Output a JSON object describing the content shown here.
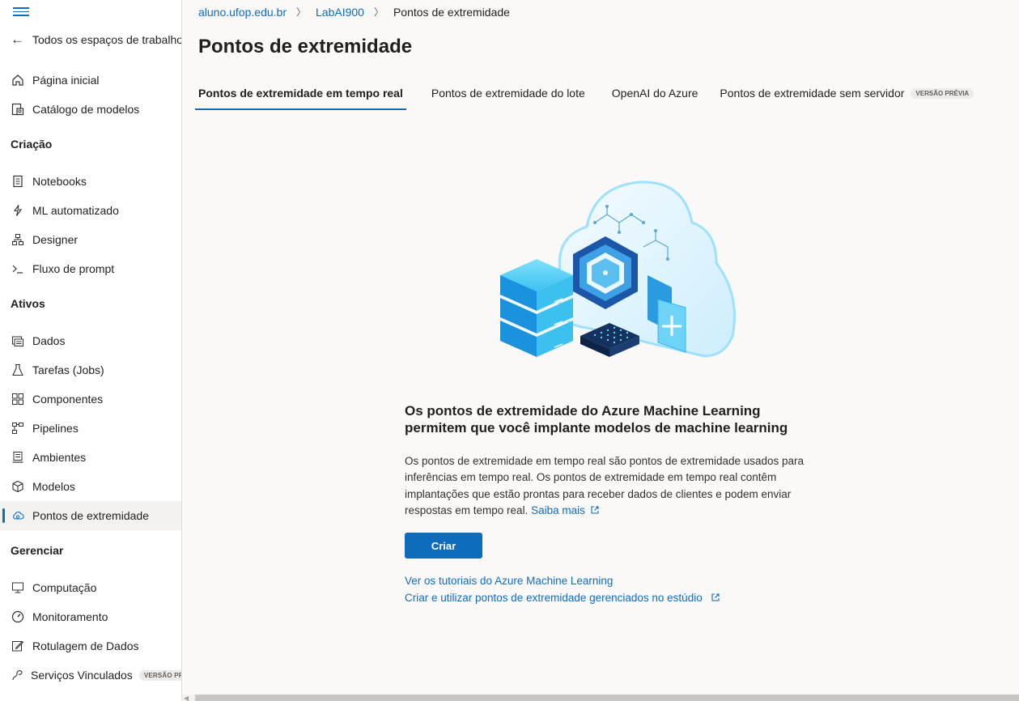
{
  "sidebar": {
    "back_label": "Todos os espaços de trabalho",
    "top_items": [
      {
        "label": "Página inicial",
        "icon": "home-icon"
      },
      {
        "label": "Catálogo de modelos",
        "icon": "catalog-icon"
      }
    ],
    "sections": [
      {
        "title": "Criação",
        "items": [
          {
            "label": "Notebooks",
            "icon": "notebook-icon"
          },
          {
            "label": "ML automatizado",
            "icon": "automl-icon"
          },
          {
            "label": "Designer",
            "icon": "designer-icon"
          },
          {
            "label": "Fluxo de prompt",
            "icon": "prompt-flow-icon"
          }
        ]
      },
      {
        "title": "Ativos",
        "items": [
          {
            "label": "Dados",
            "icon": "data-icon"
          },
          {
            "label": "Tarefas (Jobs)",
            "icon": "flask-icon"
          },
          {
            "label": "Componentes",
            "icon": "components-icon"
          },
          {
            "label": "Pipelines",
            "icon": "pipeline-icon"
          },
          {
            "label": "Ambientes",
            "icon": "environment-icon"
          },
          {
            "label": "Modelos",
            "icon": "cube-icon"
          },
          {
            "label": "Pontos de extremidade",
            "icon": "endpoint-cloud-icon",
            "active": true
          }
        ]
      },
      {
        "title": "Gerenciar",
        "items": [
          {
            "label": "Computação",
            "icon": "monitor-icon"
          },
          {
            "label": "Monitoramento",
            "icon": "gauge-icon"
          },
          {
            "label": "Rotulagem de Dados",
            "icon": "label-edit-icon"
          },
          {
            "label": "Serviços Vinculados",
            "icon": "link-icon",
            "badge": "VERSÃO PRÉVIA"
          }
        ]
      }
    ]
  },
  "breadcrumb": {
    "items": [
      "aluno.ufop.edu.br",
      "LabAI900",
      "Pontos de extremidade"
    ]
  },
  "page": {
    "title": "Pontos de extremidade",
    "tabs": [
      {
        "label": "Pontos de extremidade em tempo real",
        "active": true
      },
      {
        "label": "Pontos de extremidade do lote"
      },
      {
        "label": "OpenAI do Azure"
      },
      {
        "label": "Pontos de extremidade sem servidor",
        "badge": "VERSÃO PRÉVIA"
      }
    ]
  },
  "empty_state": {
    "title": "Os pontos de extremidade do Azure Machine Learning permitem que você implante modelos de machine learning",
    "description": "Os pontos de extremidade em tempo real são pontos de extremidade usados para inferências em tempo real. Os pontos de extremidade em tempo real contêm implantações que estão prontas para receber dados de clientes e podem enviar respostas em tempo real.",
    "learn_more": "Saiba mais",
    "create_button": "Criar",
    "link_tutorials": "Ver os tutoriais do Azure Machine Learning",
    "link_managed": "Criar e utilizar pontos de extremidade gerenciados no estúdio"
  },
  "colors": {
    "accent": "#0f6cbd",
    "background": "#faf9f8",
    "sidebar": "#ffffff"
  }
}
